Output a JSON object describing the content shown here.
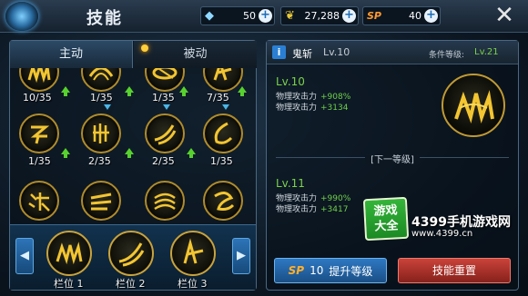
{
  "header": {
    "title": "技能",
    "currencies": [
      {
        "icon": "diamond-icon",
        "value": "50"
      },
      {
        "icon": "gold-leaf-icon",
        "value": "27,288"
      },
      {
        "icon": "sp-icon",
        "label": "SP",
        "value": "40"
      }
    ],
    "plus": "+",
    "close": "✕"
  },
  "tabs": {
    "active": "主动",
    "inactive": "被动"
  },
  "skills": [
    {
      "level": "10/35",
      "upgradable": true
    },
    {
      "level": "1/35",
      "upgradable": true
    },
    {
      "level": "1/35",
      "upgradable": true
    },
    {
      "level": "7/35",
      "upgradable": true
    },
    {
      "level": "1/35",
      "upgradable": true
    },
    {
      "level": "2/35",
      "upgradable": true
    },
    {
      "level": "2/35",
      "upgradable": true
    },
    {
      "level": "1/35",
      "upgradable": false
    }
  ],
  "slots": [
    {
      "label": "栏位 1"
    },
    {
      "label": "栏位 2"
    },
    {
      "label": "栏位 3"
    }
  ],
  "detail": {
    "name": "鬼斩",
    "level": "Lv.10",
    "req_label": "条件等级:",
    "req_value": "Lv.21",
    "current_level": "Lv.10",
    "current_stats": [
      {
        "label": "物理攻击力",
        "value": "+908%"
      },
      {
        "label": "物理攻击力",
        "value": "+3134"
      }
    ],
    "next_header": "[下一等级]",
    "next_level": "Lv.11",
    "next_stats": [
      {
        "label": "物理攻击力",
        "value": "+990%"
      },
      {
        "label": "物理攻击力",
        "value": "+3417"
      }
    ],
    "upgrade_cost": "10",
    "upgrade_sp": "SP",
    "upgrade_label": "提升等级",
    "reset_label": "技能重置"
  },
  "watermark": {
    "badge_top": "游戏",
    "badge_bottom": "大全",
    "text": "4399手机游戏网",
    "url": "www.4399.cn"
  },
  "colors": {
    "accent_gold": "#c9a33b",
    "stat_green": "#7bd24a",
    "upgrade_blue": "#2e78c2",
    "reset_red": "#c9433a"
  }
}
